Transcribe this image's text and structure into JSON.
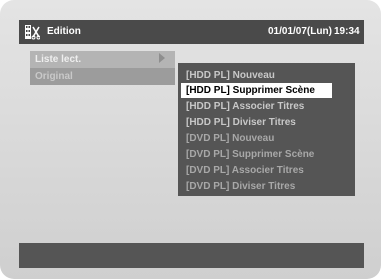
{
  "header": {
    "title": "Edition",
    "date": "01/01/07(Lun)",
    "time": "19:34",
    "icon": "edit-film-icon"
  },
  "left_menu": {
    "items": [
      {
        "label": "Liste lect.",
        "selected": true
      },
      {
        "label": "Original",
        "selected": false
      }
    ]
  },
  "submenu": {
    "items": [
      {
        "label": "[HDD PL] Nouveau",
        "enabled": true
      },
      {
        "label": "[HDD PL] Supprimer Scène",
        "enabled": true,
        "selected": true
      },
      {
        "label": "[HDD PL] Associer Titres",
        "enabled": true
      },
      {
        "label": "[HDD PL] Diviser Titres",
        "enabled": true
      },
      {
        "label": "[DVD PL] Nouveau",
        "enabled": false
      },
      {
        "label": "[DVD PL] Supprimer Scène",
        "enabled": false
      },
      {
        "label": "[DVD PL] Associer Titres",
        "enabled": false
      },
      {
        "label": "[DVD PL] Diviser Titres",
        "enabled": false
      }
    ]
  },
  "footer": {
    "text": ""
  }
}
